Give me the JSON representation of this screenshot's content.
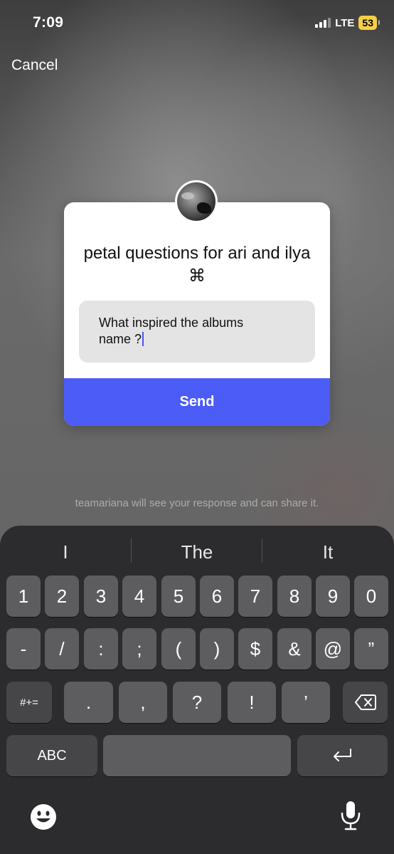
{
  "status": {
    "time": "7:09",
    "network": "LTE",
    "battery": "53"
  },
  "header": {
    "cancel_label": "Cancel"
  },
  "card": {
    "title": "petal questions for ari and ilya ⌘",
    "answer_line1": "What inspired the albums",
    "answer_line2": "name ?",
    "send_label": "Send"
  },
  "footnote": "teamariana will see your response and can share it.",
  "keyboard": {
    "suggestions": [
      "I",
      "The",
      "It"
    ],
    "row1": [
      "1",
      "2",
      "3",
      "4",
      "5",
      "6",
      "7",
      "8",
      "9",
      "0"
    ],
    "row2": [
      "-",
      "/",
      ":",
      ";",
      "(",
      ")",
      "$",
      "&",
      "@",
      "”"
    ],
    "row3_left": "#+=",
    "row3": [
      ".",
      ",",
      "?",
      "!",
      "’"
    ],
    "abc_label": "ABC"
  },
  "colors": {
    "accent": "#4c5cf7",
    "battery": "#f7cf45",
    "keyboard_bg": "#2c2c2e"
  },
  "icons": [
    "signal-icon",
    "battery-icon",
    "backspace-icon",
    "return-icon",
    "emoji-icon",
    "mic-icon"
  ]
}
